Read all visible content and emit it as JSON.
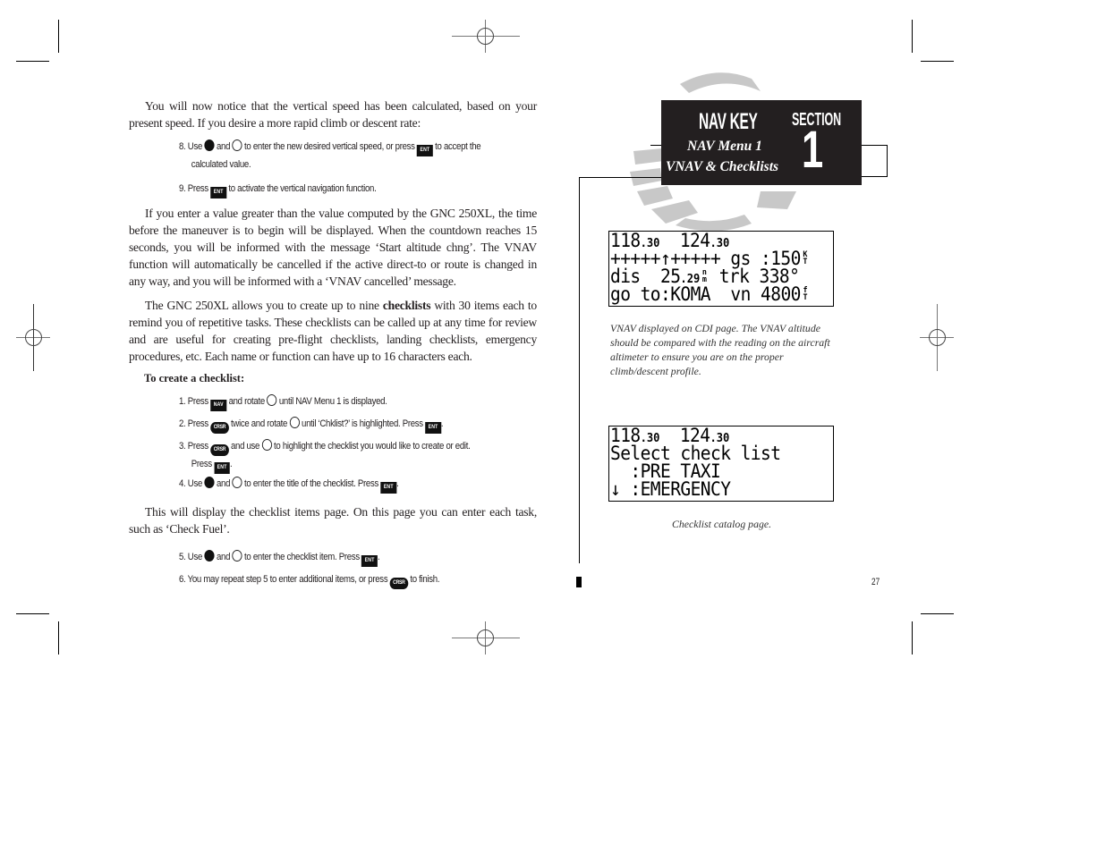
{
  "header": {
    "title": "NAV KEY",
    "subtitle_line1": "NAV Menu 1",
    "subtitle_line2": "VNAV & Checklists",
    "section_label": "SECTION",
    "section_number": "1"
  },
  "body": {
    "intro": "You will now notice that the vertical speed has been calculated, based on your present speed. If you desire a more rapid climb or descent rate:",
    "steps_vnav": [
      {
        "num": "8.",
        "parts": [
          "Use",
          "and",
          "to enter the new desired vertical speed, or press",
          "to accept the"
        ],
        "cont": "calculated value."
      },
      {
        "num": "9.",
        "parts": [
          "Press",
          "to activate the vertical navigation function."
        ]
      }
    ],
    "para_countdown": "If you enter a value greater than the value computed by the GNC 250XL, the time before the maneuver is to begin will be displayed. When the countdown reaches 15 seconds, you will be informed with the message ‘Start altitude chng’. The VNAV function will automatically be cancelled if the active direct-to or route is changed in any way, and you will be informed with a ‘VNAV cancelled’ message.",
    "para_checklists_a": "The GNC 250XL allows you to create up to nine ",
    "para_checklists_bold": "checklists",
    "para_checklists_b": " with 30 items each to remind you of repetitive tasks. These checklists can be called up at any time for review and are useful for creating pre-flight checklists, landing checklists, emergency procedures, etc. Each name or function can have up to 16 characters each.",
    "heading_create": "To create a checklist:",
    "steps_create": [
      {
        "num": "1.",
        "parts": [
          "Press",
          "and rotate",
          "until NAV Menu 1 is displayed."
        ]
      },
      {
        "num": "2.",
        "parts": [
          "Press",
          "twice and rotate",
          "until ‘Chklist?’ is highlighted. Press",
          "."
        ]
      },
      {
        "num": "3.",
        "parts": [
          "Press",
          "and use",
          "to highlight the checklist you would like to create or edit."
        ],
        "cont_a": "Press",
        "cont_b": "."
      },
      {
        "num": "4.",
        "parts": [
          "Use",
          "and",
          "to enter the title of the checklist. Press",
          "."
        ]
      }
    ],
    "para_items": "This will display the checklist items page. On this page you can enter each task, such as ‘Check Fuel’.",
    "steps_items": [
      {
        "num": "5.",
        "parts": [
          "Use",
          "and",
          "to enter the checklist item. Press",
          "."
        ]
      },
      {
        "num": "6.",
        "parts": [
          "You may repeat step 5 to enter additional items, or press",
          "to finish."
        ]
      }
    ]
  },
  "keys": {
    "ent": "ENT",
    "nav": "NAV",
    "crsr": "CRSR",
    "large_knob_icon": "knob-filled-icon",
    "small_knob_icon": "knob-open-icon"
  },
  "lcd_cdi": {
    "freq1_main": "118",
    "freq1_dec": ".30",
    "freq2_main": "124",
    "freq2_dec": ".30",
    "cdi_left": "+++++",
    "cdi_pointer": "↑",
    "cdi_right": "+++++",
    "gs_label": "gs :",
    "gs_value": "150",
    "gs_unit_top": "K",
    "gs_unit_bot": "T",
    "dis_label": "dis",
    "dis_main": "25",
    "dis_dec": ".29",
    "dis_unit_top": "n",
    "dis_unit_bot": "m",
    "trk_label": "trk",
    "trk_value": "338°",
    "goto_label": "go to:",
    "goto_value": "KOMA",
    "vn_label": "vn",
    "vn_value": "4800",
    "vn_unit_top": "f",
    "vn_unit_bot": "T"
  },
  "caption_cdi": "VNAV displayed on CDI page. The VNAV altitude should be compared with the reading on the aircraft altimeter to ensure you are on the proper climb/descent profile.",
  "lcd_checklist": {
    "freq1_main": "118",
    "freq1_dec": ".30",
    "freq2_main": "124",
    "freq2_dec": ".30",
    "title": "Select check list",
    "items": [
      {
        "prefix": "  :",
        "name": "PRE TAXI"
      },
      {
        "prefix": "↓ :",
        "name": "EMERGENCY"
      }
    ]
  },
  "caption_checklist": "Checklist catalog page.",
  "page_number": "27"
}
